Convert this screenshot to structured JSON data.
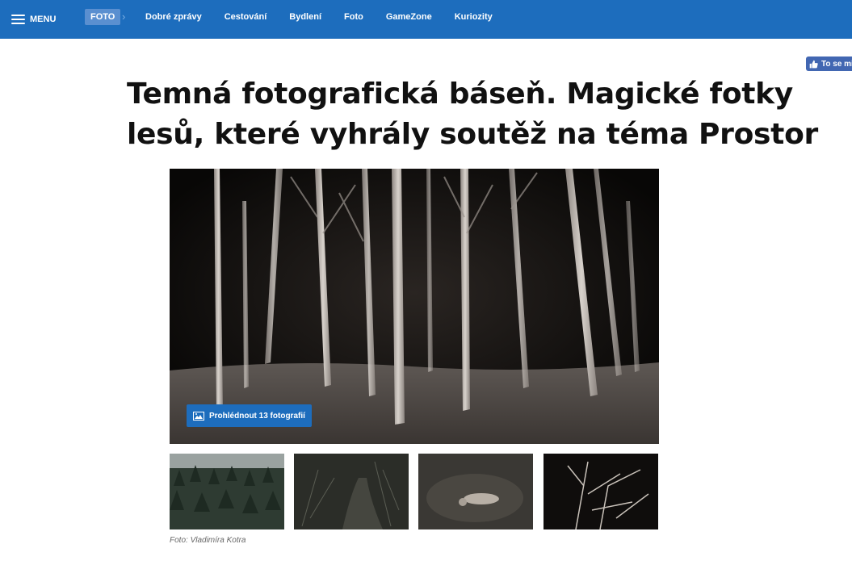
{
  "nav": {
    "menu_label": "MENU",
    "section_badge": "FOTO",
    "links": [
      "Dobré zprávy",
      "Cestování",
      "Bydlení",
      "Foto",
      "GameZone",
      "Kuriozity"
    ]
  },
  "social": {
    "like_label": "To se mi"
  },
  "article": {
    "headline_line1": "Temná fotografická báseň. Magické fotky",
    "headline_line2": "lesů, které vyhrály soutěž na téma Prostor",
    "gallery_button": "Prohlédnout 13 fotografií",
    "photo_caption": "Foto: Vladimíra Kotra"
  },
  "colors": {
    "nav_bg": "#1d6dbd",
    "badge_bg": "#5a8fd0",
    "gallery_button_bg": "#1d6dbd",
    "like_bg": "#4267b2"
  },
  "icons": {
    "menu": "hamburger-icon",
    "chevron": "chevron-right-icon",
    "like": "thumbs-up-icon",
    "gallery": "image-icon"
  }
}
